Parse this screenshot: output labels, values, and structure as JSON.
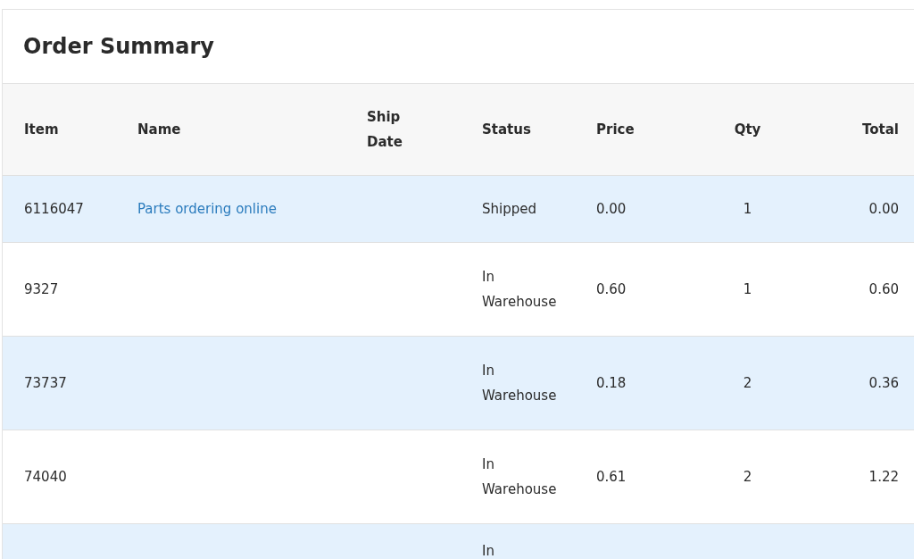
{
  "title": "Order Summary",
  "table": {
    "columns": [
      "Item",
      "Name",
      "Ship Date",
      "Status",
      "Price",
      "Qty",
      "Total"
    ],
    "rows": [
      {
        "item": "6116047",
        "name": "Parts ordering online",
        "status": "Shipped",
        "price": "0.00",
        "qty": "1",
        "total": "0.00"
      },
      {
        "item": "9327",
        "status": "In Warehouse",
        "price": "0.60",
        "qty": "1",
        "total": "0.60"
      },
      {
        "item": "73737",
        "status": "In Warehouse",
        "price": "0.18",
        "qty": "2",
        "total": "0.36"
      },
      {
        "item": "74040",
        "status": "In Warehouse",
        "price": "0.61",
        "qty": "2",
        "total": "1.22"
      },
      {
        "status": "In"
      }
    ]
  }
}
